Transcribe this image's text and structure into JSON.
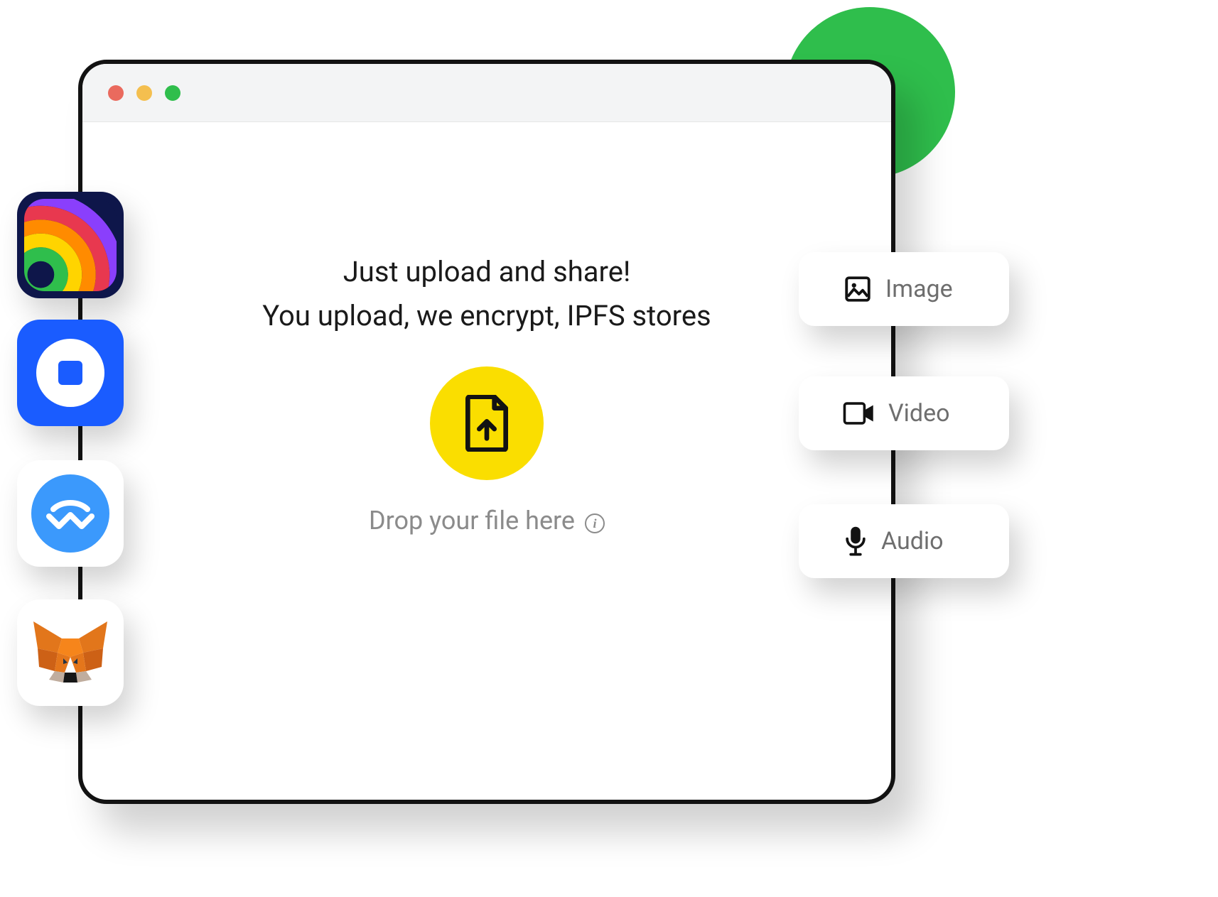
{
  "headline": {
    "line1": "Just upload and share!",
    "line2": "You upload, we encrypt, IPFS stores"
  },
  "drop_hint": "Drop your file here",
  "media_cards": [
    {
      "label": "Image",
      "icon": "image-icon"
    },
    {
      "label": "Video",
      "icon": "video-icon"
    },
    {
      "label": "Audio",
      "icon": "audio-icon"
    }
  ],
  "wallet_tiles": [
    {
      "name": "rainbow-wallet"
    },
    {
      "name": "coinbase-wallet"
    },
    {
      "name": "walletconnect"
    },
    {
      "name": "metamask"
    }
  ],
  "colors": {
    "accent_green": "#2FBE4C",
    "accent_yellow": "#FADE00",
    "window_border": "#121212"
  }
}
